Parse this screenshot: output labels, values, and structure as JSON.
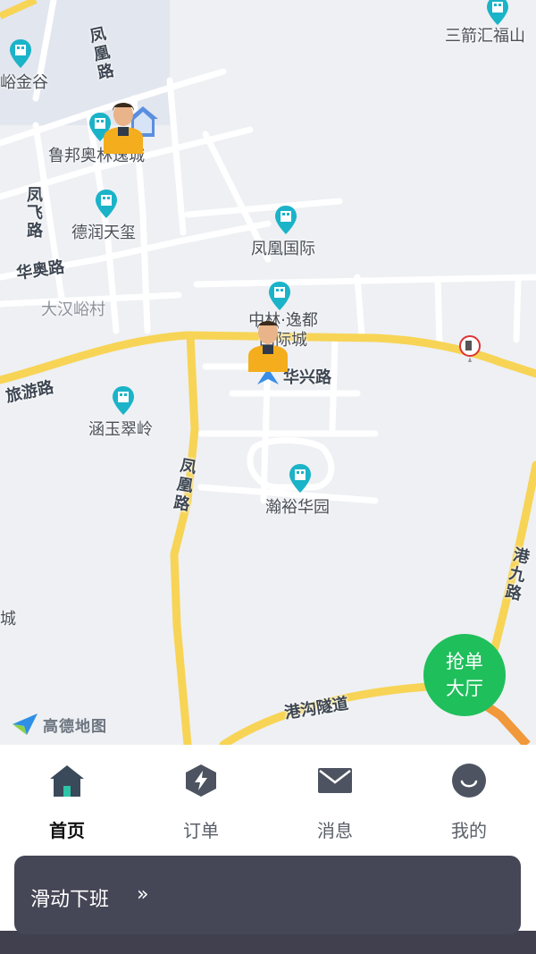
{
  "map": {
    "pois": [
      {
        "name": "三箭汇福山",
        "icon": "building-pin-icon"
      },
      {
        "name": "峪金谷",
        "icon": "building-pin-icon"
      },
      {
        "name": "鲁邦奥林逸城",
        "icon": "building-pin-icon"
      },
      {
        "name": "德润天玺",
        "icon": "building-pin-icon"
      },
      {
        "name": "凤凰国际",
        "icon": "building-pin-icon"
      },
      {
        "name": "中林·逸都国际城",
        "icon": "building-pin-icon"
      },
      {
        "name": "涵玉翠岭",
        "icon": "building-pin-icon"
      },
      {
        "name": "瀚裕华园",
        "icon": "building-pin-icon"
      }
    ],
    "roads": [
      "凤凰路",
      "凤飞路",
      "华奥路",
      "旅游路",
      "华兴路",
      "凤凰路",
      "港九路",
      "港沟隧道"
    ],
    "places": [
      "大汉峪村",
      "城"
    ],
    "logo": "高德地图",
    "grab_button": [
      "抢单",
      "大厅"
    ]
  },
  "tabs": [
    {
      "label": "首页",
      "icon": "home-icon",
      "active": true
    },
    {
      "label": "订单",
      "icon": "order-bolt-icon",
      "active": false
    },
    {
      "label": "消息",
      "icon": "mail-icon",
      "active": false
    },
    {
      "label": "我的",
      "icon": "profile-smile-icon",
      "active": false
    }
  ],
  "slide_off_work": {
    "label": "滑动下班",
    "chevron": "»"
  },
  "colors": {
    "main_road": "#f7d455",
    "grab_button": "#1fbf5b",
    "slide_bg": "#454656",
    "poi": "#1bb3c8"
  }
}
